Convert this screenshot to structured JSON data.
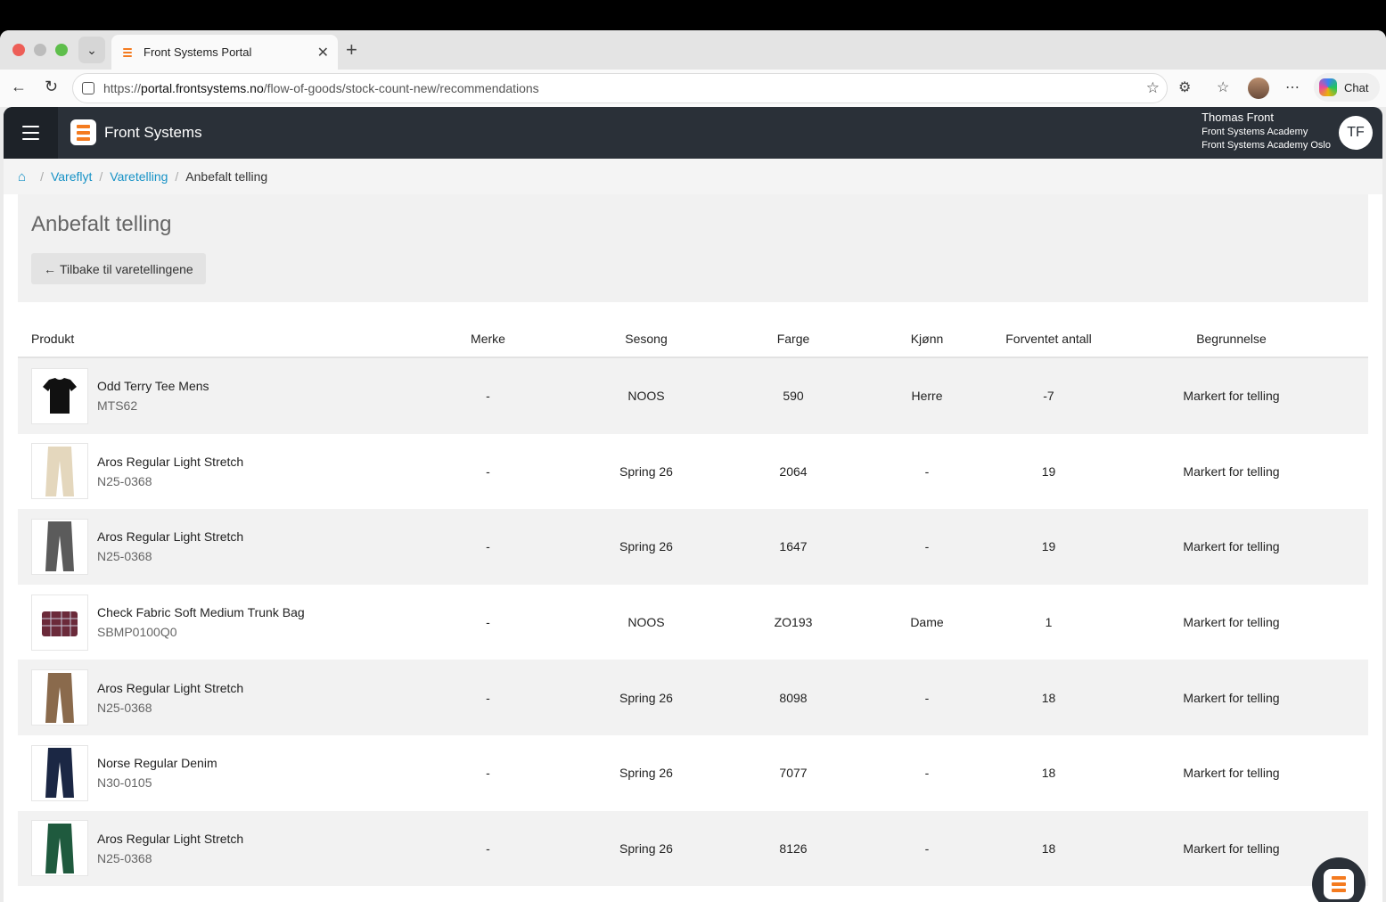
{
  "browser": {
    "tab_title": "Front Systems Portal",
    "url_prefix": "https://",
    "url_host": "portal.frontsystems.no",
    "url_path": "/flow-of-goods/stock-count-new/recommendations",
    "chat_label": "Chat"
  },
  "appbar": {
    "brand": "Front Systems",
    "user_name": "Thomas Front",
    "user_org": "Front Systems Academy",
    "user_store": "Front Systems Academy Oslo",
    "user_initials": "TF"
  },
  "breadcrumb": {
    "items": [
      "Vareflyt",
      "Varetelling"
    ],
    "current": "Anbefalt telling"
  },
  "page": {
    "title": "Anbefalt telling",
    "back_button": "Tilbake til varetellingene"
  },
  "table": {
    "headers": [
      "Produkt",
      "Merke",
      "Sesong",
      "Farge",
      "Kjønn",
      "Forventet antall",
      "Begrunnelse"
    ],
    "rows": [
      {
        "name": "Odd Terry Tee Mens",
        "code": "MTS62",
        "merke": "-",
        "sesong": "NOOS",
        "farge": "590",
        "kjonn": "Herre",
        "antall": "-7",
        "begrunnelse": "Markert for telling",
        "thumb": "tshirt-black"
      },
      {
        "name": "Aros Regular Light Stretch",
        "code": "N25-0368",
        "merke": "-",
        "sesong": "Spring 26",
        "farge": "2064",
        "kjonn": "-",
        "antall": "19",
        "begrunnelse": "Markert for telling",
        "thumb": "pants-beige"
      },
      {
        "name": "Aros Regular Light Stretch",
        "code": "N25-0368",
        "merke": "-",
        "sesong": "Spring 26",
        "farge": "1647",
        "kjonn": "-",
        "antall": "19",
        "begrunnelse": "Markert for telling",
        "thumb": "pants-grey"
      },
      {
        "name": "Check Fabric Soft Medium Trunk Bag",
        "code": "SBMP0100Q0",
        "merke": "-",
        "sesong": "NOOS",
        "farge": "ZO193",
        "kjonn": "Dame",
        "antall": "1",
        "begrunnelse": "Markert for telling",
        "thumb": "bag-check"
      },
      {
        "name": "Aros Regular Light Stretch",
        "code": "N25-0368",
        "merke": "-",
        "sesong": "Spring 26",
        "farge": "8098",
        "kjonn": "-",
        "antall": "18",
        "begrunnelse": "Markert for telling",
        "thumb": "pants-brown"
      },
      {
        "name": "Norse Regular Denim",
        "code": "N30-0105",
        "merke": "-",
        "sesong": "Spring 26",
        "farge": "7077",
        "kjonn": "-",
        "antall": "18",
        "begrunnelse": "Markert for telling",
        "thumb": "jeans-navy"
      },
      {
        "name": "Aros Regular Light Stretch",
        "code": "N25-0368",
        "merke": "-",
        "sesong": "Spring 26",
        "farge": "8126",
        "kjonn": "-",
        "antall": "18",
        "begrunnelse": "Markert for telling",
        "thumb": "pants-green"
      }
    ]
  },
  "colors": {
    "appbar": "#2a3038",
    "accent": "#f47b20",
    "link": "#1792c6",
    "thumbs": {
      "tshirt-black": "#111111",
      "pants-beige": "#e4d7bd",
      "pants-grey": "#5b5b5b",
      "bag-check": "#6b2a3a",
      "pants-brown": "#8a6a4c",
      "jeans-navy": "#1b2744",
      "pants-green": "#1f5a3e"
    }
  }
}
